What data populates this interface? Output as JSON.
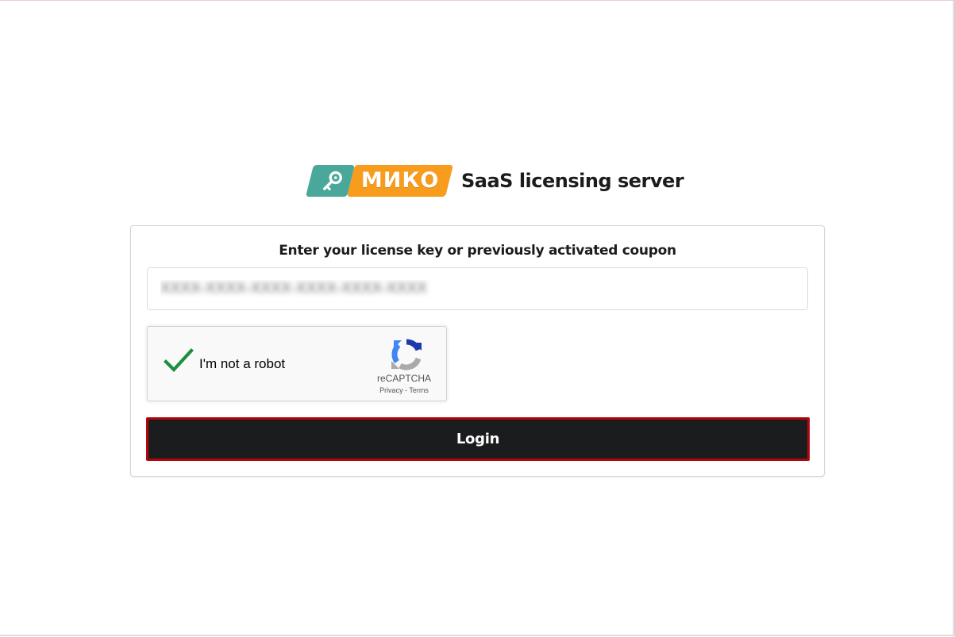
{
  "header": {
    "logo_text": "МИКО",
    "title": "SaaS licensing server"
  },
  "form": {
    "label": "Enter your license key or previously activated coupon",
    "license_value": "XXXX-XXXX-XXXX-XXXX-XXXX-XXXX"
  },
  "recaptcha": {
    "label": "I'm not a robot",
    "checked": true,
    "brand": "reCAPTCHA",
    "privacy": "Privacy",
    "separator": " - ",
    "terms": "Terms"
  },
  "login_button": {
    "label": "Login"
  },
  "colors": {
    "accent_teal": "#4aa89a",
    "accent_orange": "#f79c1c",
    "button_bg": "#1b1c1d",
    "button_border": "#b0060e",
    "check_green": "#1e8e3e"
  },
  "icons": {
    "logo_key": "key-icon",
    "check": "checkmark-icon",
    "recaptcha": "recaptcha-logo-icon"
  }
}
